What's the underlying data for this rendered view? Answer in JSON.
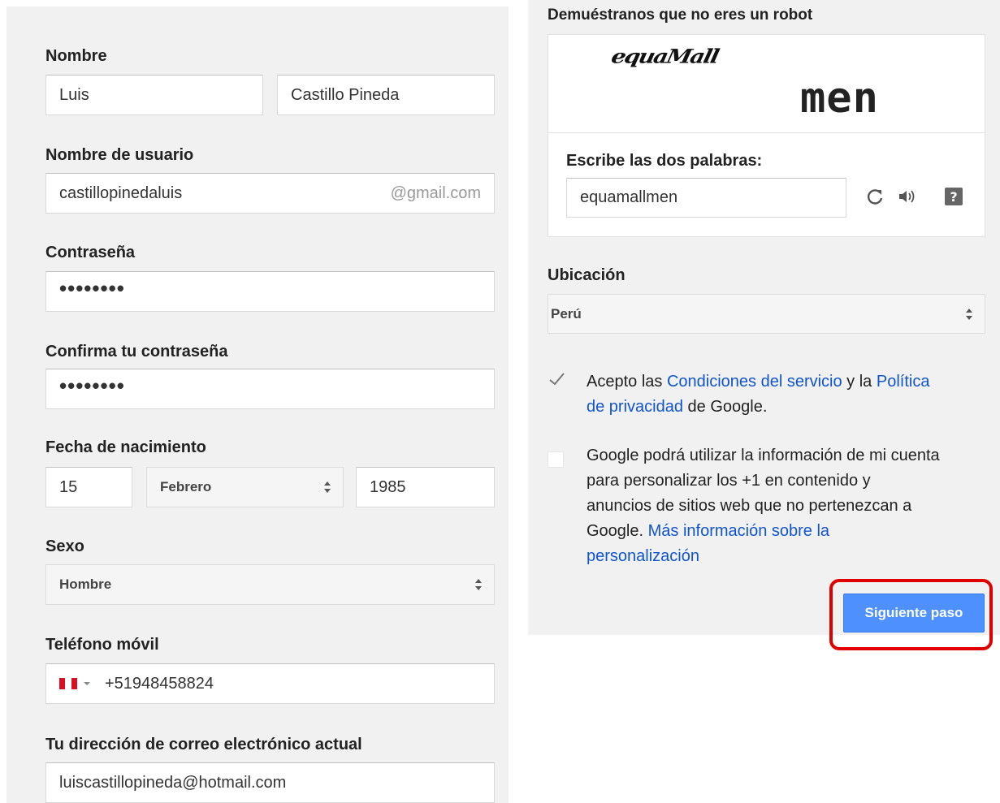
{
  "form": {
    "name": {
      "label": "Nombre",
      "first": "Luis",
      "last": "Castillo Pineda"
    },
    "username": {
      "label": "Nombre de usuario",
      "value": "castillopinedaluis",
      "suffix": "@gmail.com"
    },
    "password": {
      "label": "Contraseña",
      "masked": "••••••••"
    },
    "confirm": {
      "label": "Confirma tu contraseña",
      "masked": "••••••••"
    },
    "birth": {
      "label": "Fecha de nacimiento",
      "day": "15",
      "month": "Febrero",
      "year": "1985"
    },
    "gender": {
      "label": "Sexo",
      "value": "Hombre"
    },
    "phone": {
      "label": "Teléfono móvil",
      "flag": "peru-flag-icon",
      "value": "+51948458824"
    },
    "email": {
      "label": "Tu dirección de correo electrónico actual",
      "value": "luiscastillopineda@hotmail.com"
    }
  },
  "captcha": {
    "title": "Demuéstranos que no eres un robot",
    "word1": "equaMall",
    "word2": "men",
    "prompt": "Escribe las dos palabras:",
    "value": "equamallmen",
    "icons": [
      "refresh-icon",
      "audio-icon",
      "help-icon"
    ]
  },
  "location": {
    "label": "Ubicación",
    "value": "Perú"
  },
  "terms": {
    "checked": true,
    "prefix": "Acepto las ",
    "link1": "Condiciones del servicio",
    "middle": " y la ",
    "link2a": "Política",
    "link2b": "de privacidad",
    "suffix": " de Google."
  },
  "personalize": {
    "checked": false,
    "line1": "Google podrá utilizar la información de mi cuenta",
    "line2": "para personalizar los +1 en contenido y",
    "line3": "anuncios de sitios web que no pertenezcan a",
    "line4_text": "Google. ",
    "line4_link": "Más información sobre la",
    "line5_link": "personalización"
  },
  "next_button": "Siguiente paso",
  "colors": {
    "primary_button": "#4d90fe",
    "link": "#1155cc",
    "highlight": "#e00000"
  }
}
